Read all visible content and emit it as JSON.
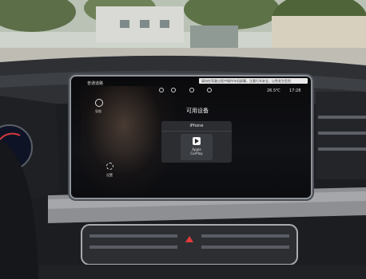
{
  "statusbar": {
    "mode_label": "普通道路",
    "notice": "请勿在驾驶过程中操作车机屏幕，注意行车安全，以免发生危险",
    "temperature": "26.5℃",
    "time": "17:28"
  },
  "sidebar": {
    "home_label": "导航",
    "settings_label": "设置"
  },
  "dialog": {
    "title": "可用设备",
    "device_name": "iPhone",
    "option_line1": "Apple",
    "option_line2": "CarPlay"
  }
}
